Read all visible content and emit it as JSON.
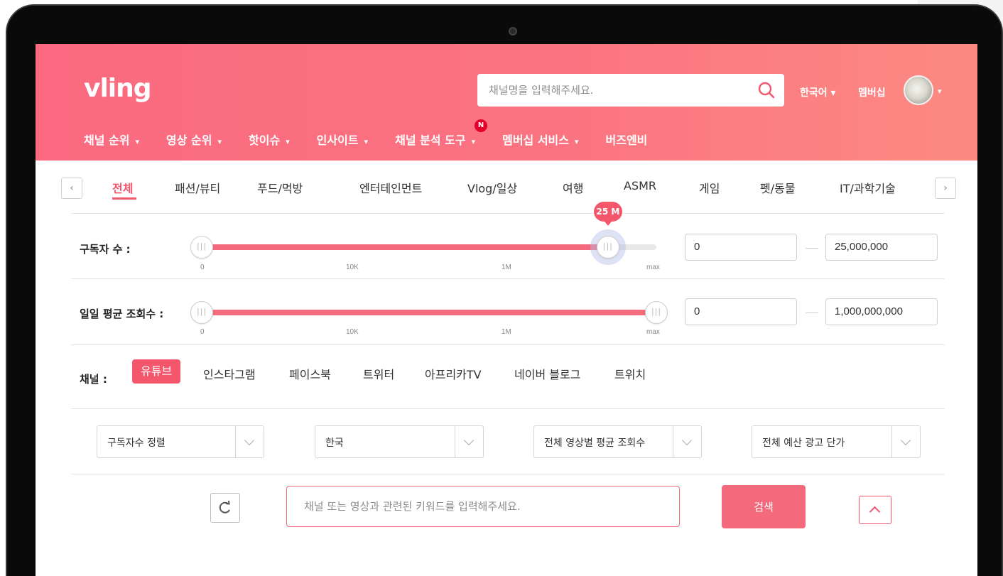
{
  "app": {
    "logo": "vling"
  },
  "header": {
    "search_placeholder": "채널명을 입력해주세요.",
    "language": "한국어 ▾",
    "membership": "멤버십",
    "avatar_caret": "▾"
  },
  "gnb": {
    "items": [
      {
        "label": "채널 순위",
        "caret": "▾"
      },
      {
        "label": "영상 순위",
        "caret": "▾"
      },
      {
        "label": "핫이슈",
        "caret": "▾"
      },
      {
        "label": "인사이트",
        "caret": "▾"
      },
      {
        "label": "채널 분석 도구",
        "caret": "▾",
        "badge": "N"
      },
      {
        "label": "멤버십 서비스",
        "caret": "▾"
      },
      {
        "label": "버즈엔비",
        "caret": ""
      }
    ]
  },
  "categories": {
    "prev": "‹",
    "next": "›",
    "tabs": [
      "전체",
      "패션/뷰티",
      "푸드/먹방",
      "엔터테인먼트",
      "Vlog/일상",
      "여행",
      "ASMR",
      "게임",
      "펫/동물",
      "IT/과학기술"
    ],
    "active": "전체"
  },
  "subscribers": {
    "label": "구독자 수 :",
    "ticks": [
      "0",
      "10K",
      "1M",
      "max"
    ],
    "bubble": "25 M",
    "min_value": "0",
    "max_value": "25,000,000",
    "level": 0.894,
    "handle_grip": "|||"
  },
  "daily_views": {
    "label": "일일 평균 조회수 :",
    "ticks": [
      "0",
      "10K",
      "1M",
      "max"
    ],
    "min_value": "0",
    "max_value": "1,000,000,000",
    "level": 1.0,
    "handle_grip": "|||"
  },
  "channel": {
    "label": "채널 :",
    "options": [
      "유튜브",
      "인스타그램",
      "페이스북",
      "트위터",
      "아프리카TV",
      "네이버 블로그",
      "트위치"
    ],
    "active": "유튜브"
  },
  "filters": {
    "sort": "구독자수 정렬",
    "country": "한국",
    "views": "전체 영상별 평균 조회수",
    "budget": "전체 예산 광고 단가"
  },
  "keyword": {
    "placeholder": "채널 또는 영상과 관련된 키워드를 입력해주세요.",
    "search_label": "검색"
  },
  "colors": {
    "brand": "#f4566c",
    "header_start": "#fb6a80",
    "header_end": "#fc8a82"
  }
}
